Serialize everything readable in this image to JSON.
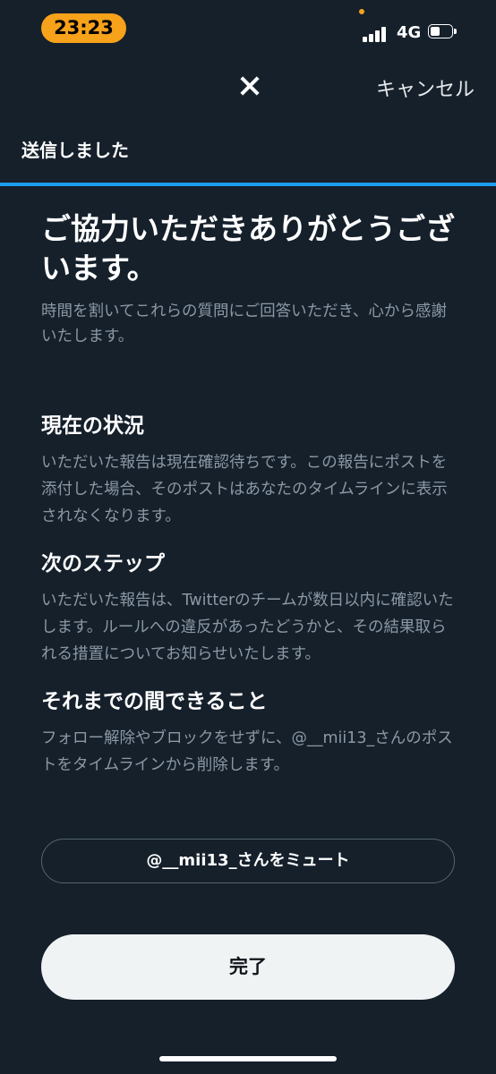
{
  "status_bar": {
    "time": "23:23",
    "network": "4G",
    "signal_bars": 4,
    "battery_level": 0.5
  },
  "header": {
    "logo_icon": "x-logo-icon",
    "cancel_label": "キャンセル"
  },
  "step": {
    "label": "送信しました",
    "progress": 1.0,
    "progress_color": "#1d9bf0"
  },
  "main": {
    "title": "ご協力いただきありがとうございます。",
    "lead": "時間を割いてこれらの質問にご回答いただき、心から感謝いたします。",
    "sections": [
      {
        "title": "現在の状況",
        "body": "いただいた報告は現在確認待ちです。この報告にポストを添付した場合、そのポストはあなたのタイムラインに表示されなくなります。"
      },
      {
        "title": "次のステップ",
        "body": "いただいた報告は、Twitterのチームが数日以内に確認いたします。ルールへの違反があったどうかと、その結果取られる措置についてお知らせいたします。"
      },
      {
        "title": "それまでの間できること",
        "body": "フォロー解除やブロックをせずに、@__mii13_さんのポストをタイムラインから削除します。"
      }
    ],
    "mute_button_label": "@__mii13_さんをミュート",
    "done_button_label": "完了"
  },
  "colors": {
    "background": "#15202b",
    "accent": "#1d9bf0",
    "time_pill": "#f7a21b"
  }
}
